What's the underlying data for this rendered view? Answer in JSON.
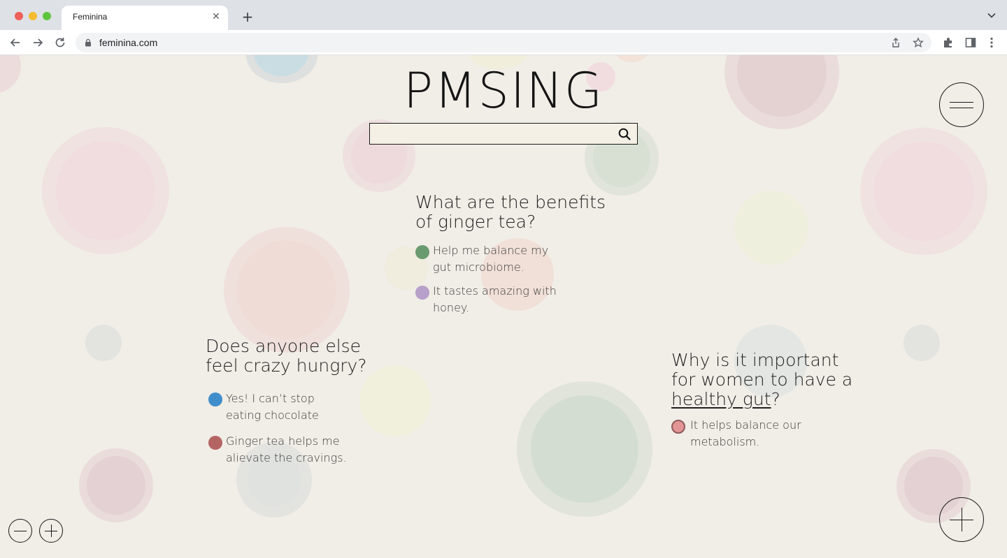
{
  "browser": {
    "tab_title": "Feminina",
    "tab_close_glyph": "✕",
    "new_tab_glyph": "+",
    "url": "feminina.com",
    "icons": [
      "back-arrow-icon",
      "forward-arrow-icon",
      "reload-icon",
      "lock-icon",
      "share-icon",
      "bookmark-star-icon",
      "extensions-icon",
      "side-panel-icon",
      "more-menu-icon",
      "tab-list-chevron-icon"
    ]
  },
  "site": {
    "logo": "PMSING",
    "search": {
      "value": "",
      "placeholder": ""
    }
  },
  "colors": {
    "page_bg": "#f1ede7",
    "green_dot": "#6a9a6f",
    "lilac_dot": "#b7a0c9",
    "blue_dot": "#3f8ecb",
    "rose_dot": "#b56464",
    "pink_dot": "#e39494"
  },
  "posts": [
    {
      "question_lines": [
        "What are the benefits",
        "of ginger tea?"
      ],
      "answers": [
        {
          "lines": [
            "Help me balance my",
            "gut microbiome."
          ],
          "dot": "green"
        },
        {
          "lines": [
            "It tastes amazing with",
            "honey."
          ],
          "dot": "lilac"
        }
      ]
    },
    {
      "question_lines": [
        "Does anyone else",
        "feel crazy hungry?"
      ],
      "answers": [
        {
          "lines": [
            "Yes! I can’t stop",
            "eating chocolate"
          ],
          "dot": "blue"
        },
        {
          "lines": [
            "Ginger tea helps me",
            "alievate the cravings."
          ],
          "dot": "rose"
        }
      ]
    },
    {
      "question_lines": [
        "Why is it important",
        "for women to have a"
      ],
      "question_link": "healthy gut",
      "question_tail": "?",
      "answers": [
        {
          "lines": [
            "It helps balance our",
            "metabolism."
          ],
          "dot": "pink"
        }
      ]
    }
  ]
}
